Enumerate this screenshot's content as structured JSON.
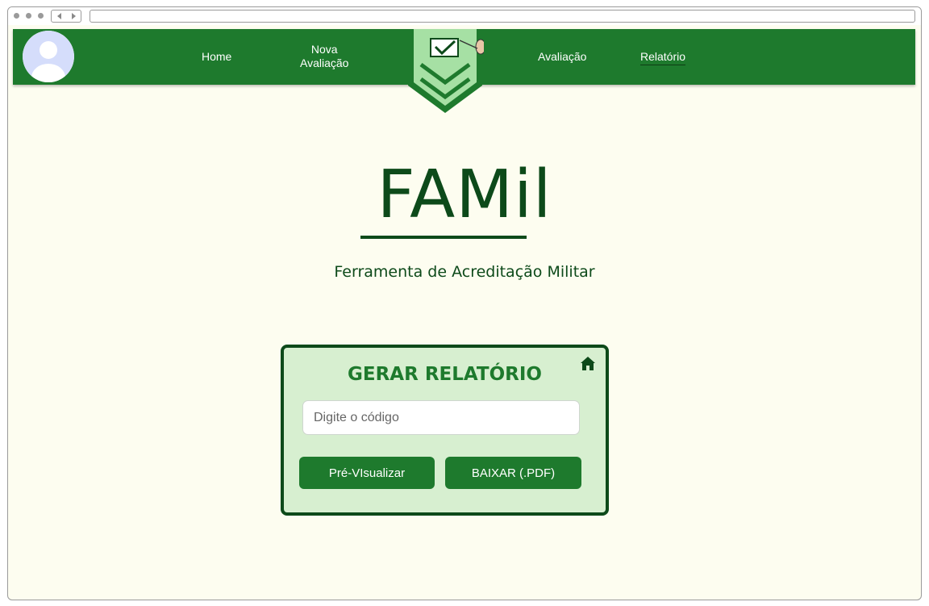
{
  "browser": {
    "controls": [
      "dot-1",
      "dot-2",
      "dot-3"
    ],
    "nav_icons": [
      "back-icon",
      "forward-icon"
    ]
  },
  "navbar": {
    "avatar_icon": "user-avatar-icon",
    "items": [
      {
        "label_lines": [
          "Home"
        ]
      },
      {
        "label_lines": [
          "Nova",
          "Avaliação"
        ]
      },
      {
        "label_lines": [
          "Avaliação"
        ]
      },
      {
        "label_lines": [
          "Relatório"
        ],
        "active": true
      }
    ],
    "logo_icon": "shield-checkmark-logo"
  },
  "brand": {
    "title": "FAMil",
    "subtitle": "Ferramenta de Acreditação Militar"
  },
  "report_card": {
    "title": "GERAR RELATÓRIO",
    "home_icon": "home-icon",
    "code_input": {
      "placeholder": "Digite o código",
      "value": ""
    },
    "preview_label": "Pré-VIsualizar",
    "download_label": "BAIXAR (.PDF)"
  },
  "colors": {
    "navbar": "#1e7a2d",
    "page_background": "#fdfdf0",
    "brand_text": "#0d4a1a",
    "card_background": "#d7efd0",
    "button": "#1e7a2d"
  }
}
